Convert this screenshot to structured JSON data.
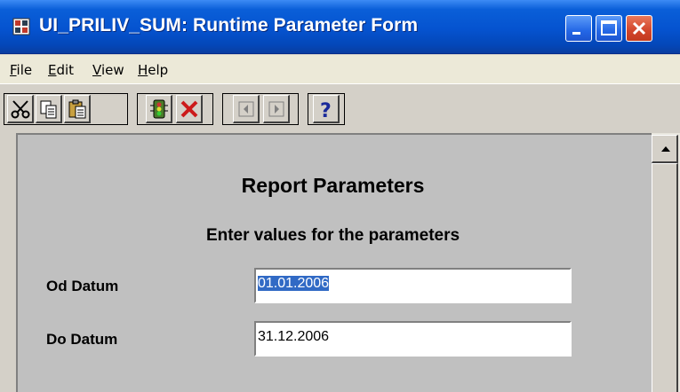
{
  "window": {
    "title": "UI_PRILIV_SUM: Runtime Parameter Form",
    "icon": "oracle-reports-icon"
  },
  "title_buttons": {
    "minimize": "minimize-icon",
    "maximize": "maximize-icon",
    "close": "close-icon"
  },
  "menu": {
    "items": [
      {
        "label": "File",
        "mnemonic": "F"
      },
      {
        "label": "Edit",
        "mnemonic": "E"
      },
      {
        "label": "View",
        "mnemonic": "V"
      },
      {
        "label": "Help",
        "mnemonic": "H"
      }
    ]
  },
  "toolbar": {
    "buttons": [
      "cut-icon",
      "copy-icon",
      "paste-icon",
      "run-report-icon",
      "cancel-icon",
      "previous-icon",
      "next-icon",
      "help-icon"
    ]
  },
  "form": {
    "heading": "Report Parameters",
    "subheading": "Enter values for the parameters",
    "fields": [
      {
        "label": "Od Datum",
        "value": "01.01.2006",
        "selected": true
      },
      {
        "label": "Do Datum",
        "value": "31.12.2006",
        "selected": false
      }
    ]
  },
  "colors": {
    "titlebar": "#0553d0",
    "close_button": "#d2452b",
    "selection": "#316ac5",
    "form_background": "#c0c0c0"
  }
}
